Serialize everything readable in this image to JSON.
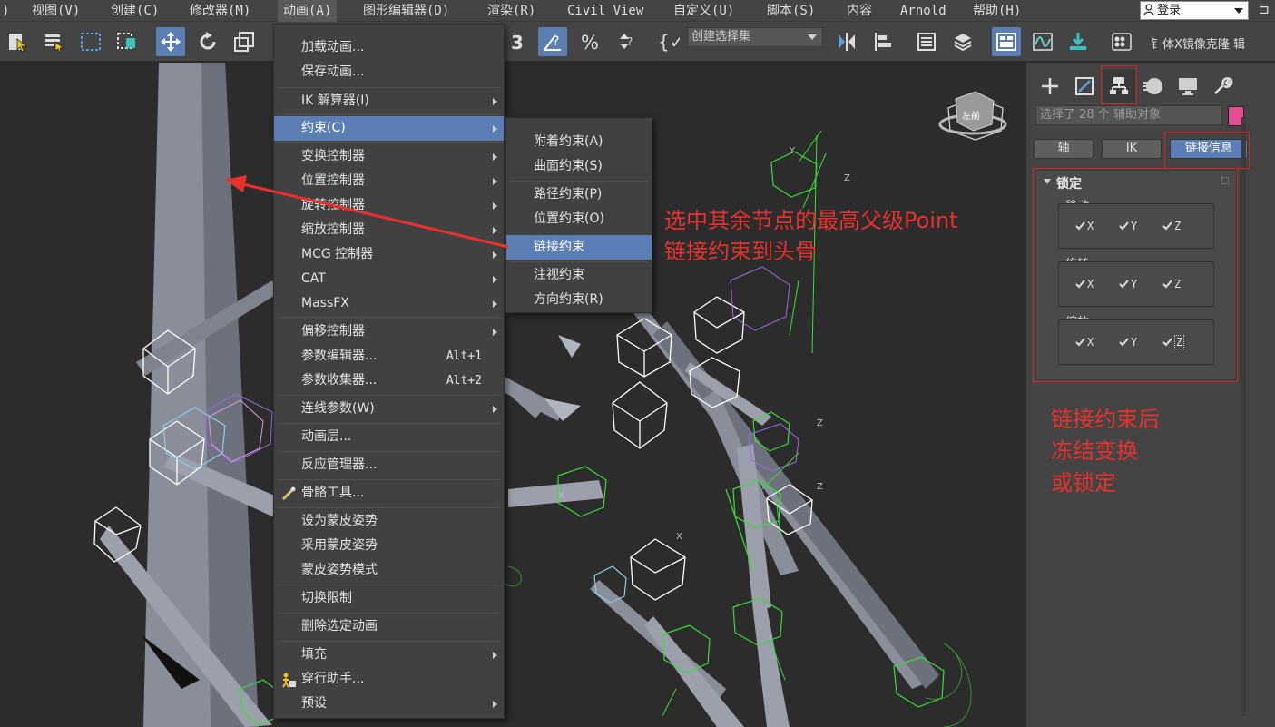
{
  "menubar": {
    "items": [
      ")",
      "视图(V)",
      "创建(C)",
      "修改器(M)",
      "动画(A)",
      "图形编辑器(D)",
      "渲染(R)",
      "Civil View",
      "自定义(U)",
      "脚本(S)",
      "内容",
      "Arnold",
      "帮助(H)"
    ],
    "active_index": 4,
    "login_label": "登录"
  },
  "toolbar": {
    "selection_set_placeholder": "创建选择集",
    "script_label": "钅体X镜像克隆 辑"
  },
  "animation_menu": {
    "items": [
      {
        "label": "加载动画...",
        "shortcut": "",
        "submenu": false
      },
      {
        "label": "保存动画...",
        "shortcut": "",
        "submenu": false
      },
      {
        "label": "IK 解算器(I)",
        "shortcut": "",
        "submenu": true
      },
      {
        "label": "约束(C)",
        "shortcut": "",
        "submenu": true
      },
      {
        "label": "变换控制器",
        "shortcut": "",
        "submenu": true
      },
      {
        "label": "位置控制器",
        "shortcut": "",
        "submenu": true
      },
      {
        "label": "旋转控制器",
        "shortcut": "",
        "submenu": true
      },
      {
        "label": "缩放控制器",
        "shortcut": "",
        "submenu": true
      },
      {
        "label": "MCG 控制器",
        "shortcut": "",
        "submenu": true
      },
      {
        "label": "CAT",
        "shortcut": "",
        "submenu": true
      },
      {
        "label": "MassFX",
        "shortcut": "",
        "submenu": true
      },
      {
        "label": "偏移控制器",
        "shortcut": "",
        "submenu": true
      },
      {
        "label": "参数编辑器...",
        "shortcut": "Alt+1",
        "submenu": false
      },
      {
        "label": "参数收集器...",
        "shortcut": "Alt+2",
        "submenu": false
      },
      {
        "label": "连线参数(W)",
        "shortcut": "",
        "submenu": true
      },
      {
        "label": "动画层...",
        "shortcut": "",
        "submenu": false
      },
      {
        "label": "反应管理器...",
        "shortcut": "",
        "submenu": false
      },
      {
        "label": "骨骼工具...",
        "shortcut": "",
        "submenu": false
      },
      {
        "label": "设为蒙皮姿势",
        "shortcut": "",
        "submenu": false
      },
      {
        "label": "采用蒙皮姿势",
        "shortcut": "",
        "submenu": false
      },
      {
        "label": "蒙皮姿势模式",
        "shortcut": "",
        "submenu": false
      },
      {
        "label": "切换限制",
        "shortcut": "",
        "submenu": false
      },
      {
        "label": "删除选定动画",
        "shortcut": "",
        "submenu": false
      },
      {
        "label": "填充",
        "shortcut": "",
        "submenu": true
      },
      {
        "label": "穿行助手...",
        "shortcut": "",
        "submenu": false
      },
      {
        "label": "预设",
        "shortcut": "",
        "submenu": true
      }
    ],
    "highlighted_index": 3
  },
  "constraints_submenu": {
    "items": [
      "附着约束(A)",
      "曲面约束(S)",
      "路径约束(P)",
      "位置约束(O)",
      "链接约束",
      "注视约束",
      "方向约束(R)"
    ],
    "highlighted_index": 4
  },
  "command_panel": {
    "selection_text": "选择了 28 个 辅助对象",
    "swatch_color": "#e0508f",
    "buttons": [
      "轴",
      "IK",
      "链接信息"
    ],
    "active_button_index": 2,
    "rollout_title": "锁定",
    "groups": [
      {
        "label": "移动:",
        "axes": [
          "X",
          "Y",
          "Z"
        ]
      },
      {
        "label": "旋转:",
        "axes": [
          "X",
          "Y",
          "Z"
        ]
      },
      {
        "label": "缩放:",
        "axes": [
          "X",
          "Y",
          "Z"
        ]
      }
    ]
  },
  "annotations": {
    "center_line1": "选中其余节点的最高父级Point",
    "center_line2": "链接约束到头骨",
    "right_line1": "链接约束后",
    "right_line2": "冻结变换",
    "right_line3": "或锁定",
    "color": "#e8312c"
  },
  "viewcube_label": "左前"
}
